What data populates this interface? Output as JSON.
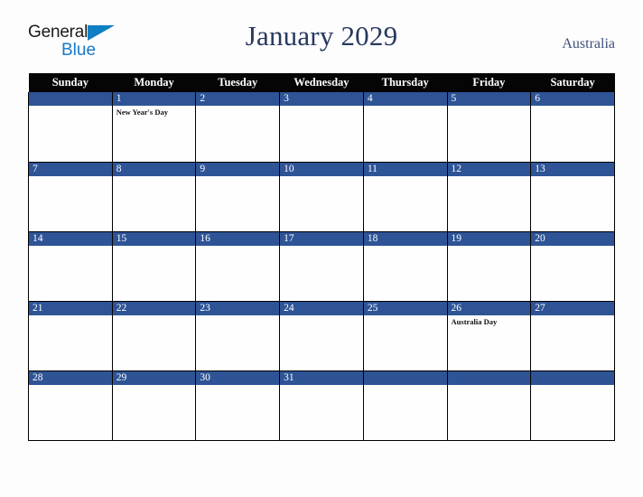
{
  "brand": {
    "name_part1": "General",
    "name_part2": "Blue",
    "triangle_color": "#0f7fc4",
    "text_color_part1": "#1b1b1b",
    "text_color_part2": "#1878c8"
  },
  "header": {
    "title": "January 2029",
    "region": "Australia",
    "title_color": "#27395f",
    "region_color": "#3c5178"
  },
  "calendar": {
    "month": "January",
    "year": "2029",
    "day_headers": [
      "Sunday",
      "Monday",
      "Tuesday",
      "Wednesday",
      "Thursday",
      "Friday",
      "Saturday"
    ],
    "header_bg": "#050505",
    "header_text_color": "#ffffff",
    "daynum_bar_color": "#2e5496",
    "daynum_text_color": "#ffffff",
    "grid_border_color": "#000000",
    "cell_bg": "#fefefe",
    "weeks": [
      [
        {
          "day": "",
          "events": []
        },
        {
          "day": "1",
          "events": [
            "New Year's Day"
          ]
        },
        {
          "day": "2",
          "events": []
        },
        {
          "day": "3",
          "events": []
        },
        {
          "day": "4",
          "events": []
        },
        {
          "day": "5",
          "events": []
        },
        {
          "day": "6",
          "events": []
        }
      ],
      [
        {
          "day": "7",
          "events": []
        },
        {
          "day": "8",
          "events": []
        },
        {
          "day": "9",
          "events": []
        },
        {
          "day": "10",
          "events": []
        },
        {
          "day": "11",
          "events": []
        },
        {
          "day": "12",
          "events": []
        },
        {
          "day": "13",
          "events": []
        }
      ],
      [
        {
          "day": "14",
          "events": []
        },
        {
          "day": "15",
          "events": []
        },
        {
          "day": "16",
          "events": []
        },
        {
          "day": "17",
          "events": []
        },
        {
          "day": "18",
          "events": []
        },
        {
          "day": "19",
          "events": []
        },
        {
          "day": "20",
          "events": []
        }
      ],
      [
        {
          "day": "21",
          "events": []
        },
        {
          "day": "22",
          "events": []
        },
        {
          "day": "23",
          "events": []
        },
        {
          "day": "24",
          "events": []
        },
        {
          "day": "25",
          "events": []
        },
        {
          "day": "26",
          "events": [
            "Australia Day"
          ]
        },
        {
          "day": "27",
          "events": []
        }
      ],
      [
        {
          "day": "28",
          "events": []
        },
        {
          "day": "29",
          "events": []
        },
        {
          "day": "30",
          "events": []
        },
        {
          "day": "31",
          "events": []
        },
        {
          "day": "",
          "events": []
        },
        {
          "day": "",
          "events": []
        },
        {
          "day": "",
          "events": []
        }
      ]
    ]
  }
}
